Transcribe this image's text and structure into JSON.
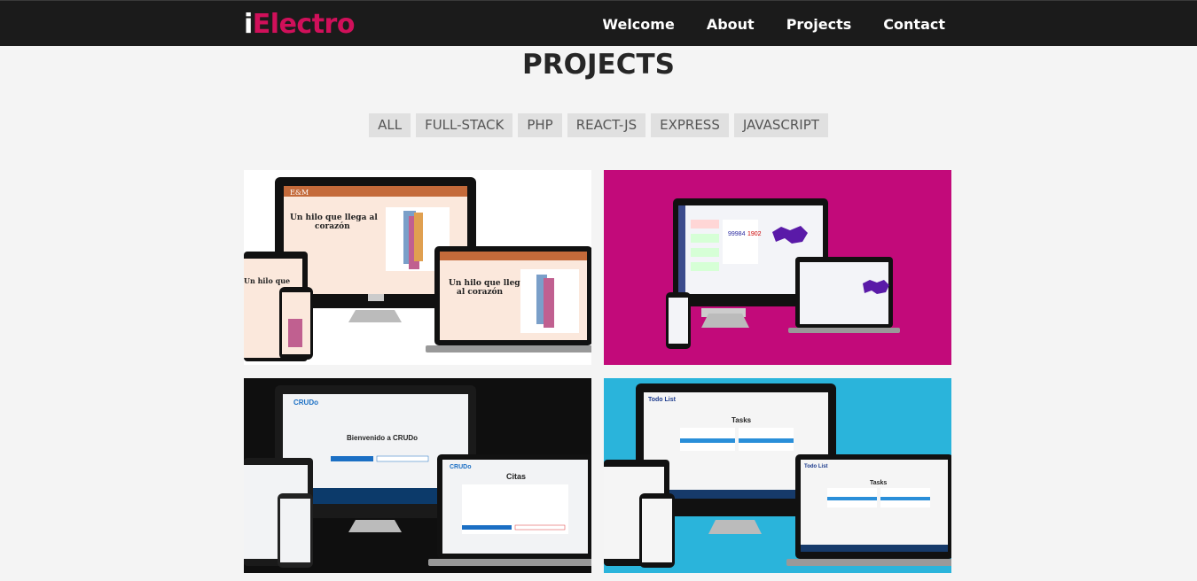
{
  "brand": {
    "prefix": "i",
    "name": "Electro"
  },
  "nav": [
    {
      "label": "Welcome"
    },
    {
      "label": "About"
    },
    {
      "label": "Projects"
    },
    {
      "label": "Contact"
    }
  ],
  "page_title": "PROJECTS",
  "filters": [
    "ALL",
    "FULL-STACK",
    "PHP",
    "REACT-JS",
    "EXPRESS",
    "JAVASCRIPT"
  ],
  "projects": [
    {
      "bg": "#ffffff",
      "screen": "#fbe8dc",
      "accent": "#c46a3a",
      "logo": "E&M",
      "headline": "Un hilo que llega al corazón"
    },
    {
      "bg": "#c20a7a",
      "screen": "#f3f4f8",
      "accent": "#5a2aa8",
      "logo": "",
      "headline": ""
    },
    {
      "bg": "#0f0f0f",
      "screen": "#f2f3f5",
      "accent": "#1b6fc4",
      "logo": "CRUDo",
      "headline": "Bienvenido a CRUDo",
      "sub": "Citas"
    },
    {
      "bg": "#2ab4db",
      "screen": "#f5f5f5",
      "accent": "#2a8fd9",
      "logo": "Todo List",
      "headline": "Tasks"
    }
  ]
}
